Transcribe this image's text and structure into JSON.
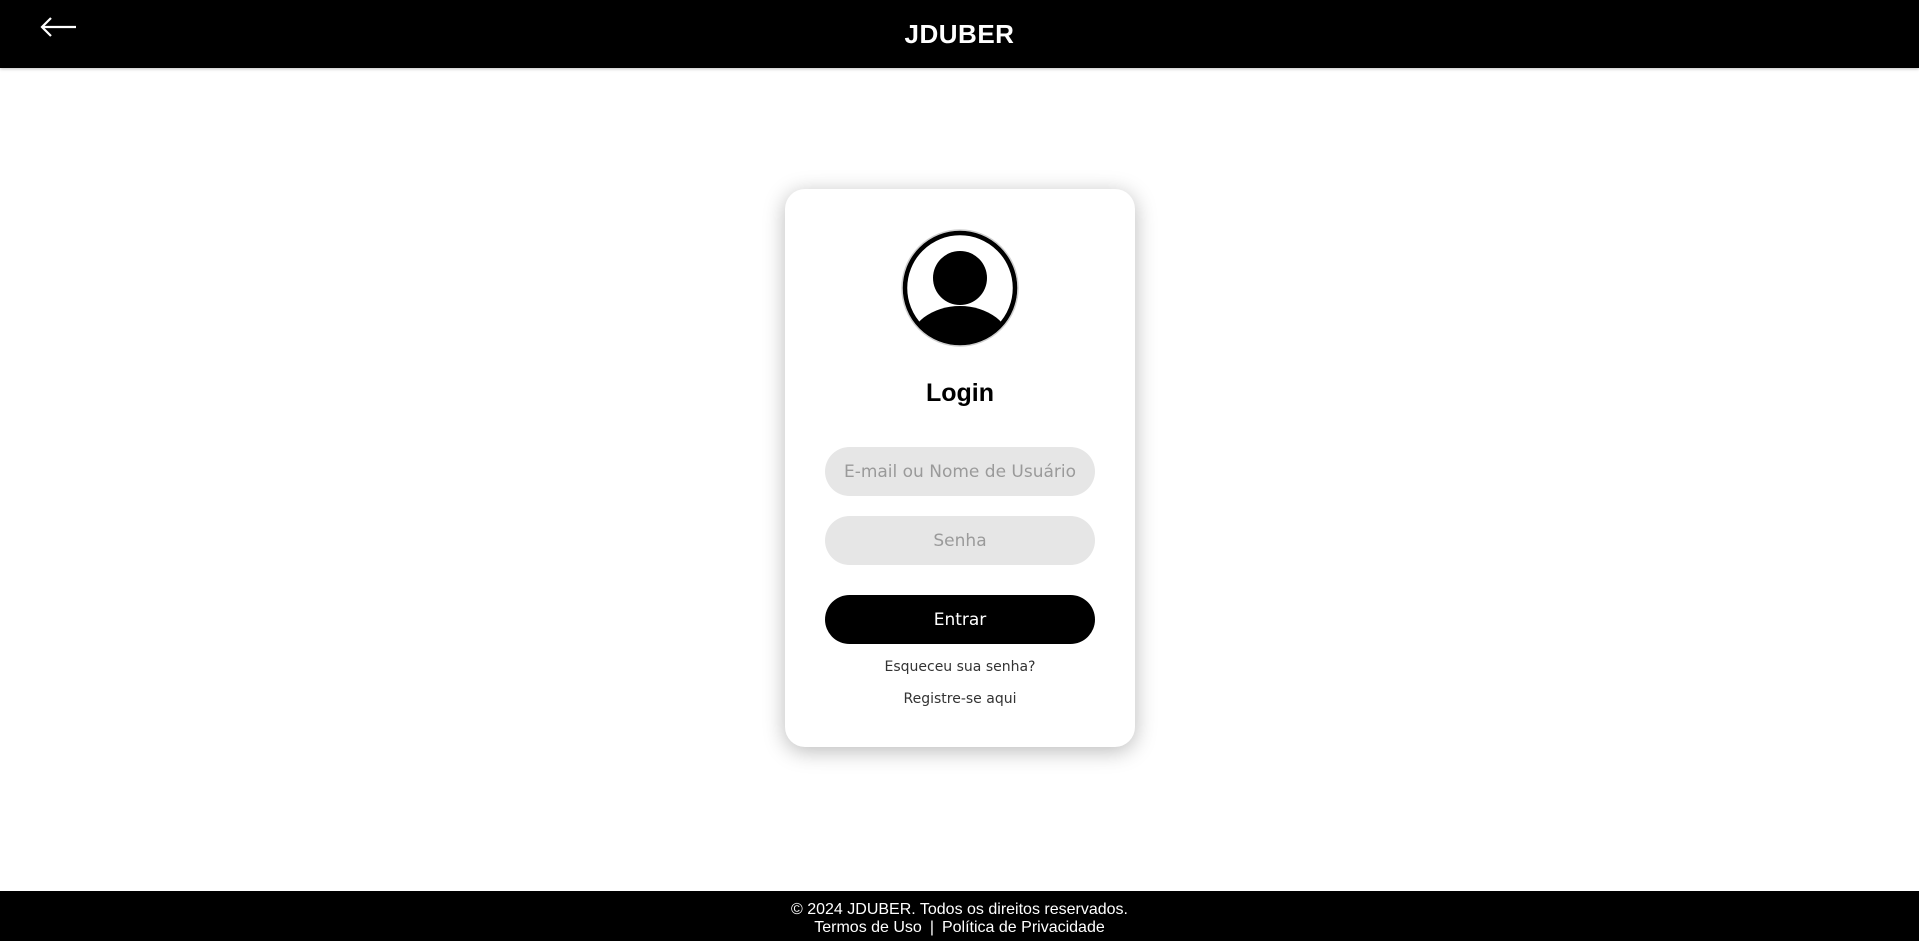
{
  "header": {
    "back_icon": "arrow-left-icon",
    "brand": "JDUBER"
  },
  "login": {
    "avatar_icon": "user-avatar-icon",
    "title": "Login",
    "user_placeholder": "E-mail ou Nome de Usuário",
    "user_value": "",
    "password_placeholder": "Senha",
    "password_value": "",
    "submit_label": "Entrar",
    "forgot_label": "Esqueceu sua senha?",
    "register_label": "Registre-se aqui"
  },
  "footer": {
    "copyright": "© 2024 JDUBER. Todos os direitos reservados.",
    "terms_label": "Termos de Uso",
    "separator": "|",
    "privacy_label": "Política de Privacidade"
  },
  "colors": {
    "header_bg": "#000000",
    "field_bg": "#e6e6e6",
    "button_bg": "#000000",
    "page_bg": "#ffffff"
  }
}
